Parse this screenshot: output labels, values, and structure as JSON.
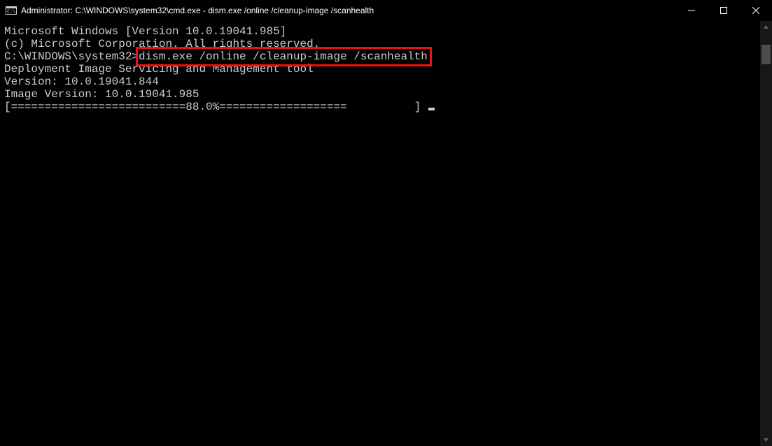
{
  "titlebar": {
    "title": "Administrator: C:\\WINDOWS\\system32\\cmd.exe - dism.exe  /online /cleanup-image /scanhealth"
  },
  "terminal": {
    "line1": "Microsoft Windows [Version 10.0.19041.985]",
    "line2": "(c) Microsoft Corporation. All rights reserved.",
    "blank1": "",
    "promptPrefix": "C:\\WINDOWS\\system32>",
    "command": "dism.exe /online /cleanup-image /scanhealth",
    "blank2": "",
    "tool1": "Deployment Image Servicing and Management tool",
    "tool2": "Version: 10.0.19041.844",
    "blank3": "",
    "imgver": "Image Version: 10.0.19041.985",
    "blank4": "",
    "progress": "[==========================88.0%===================          ] "
  }
}
